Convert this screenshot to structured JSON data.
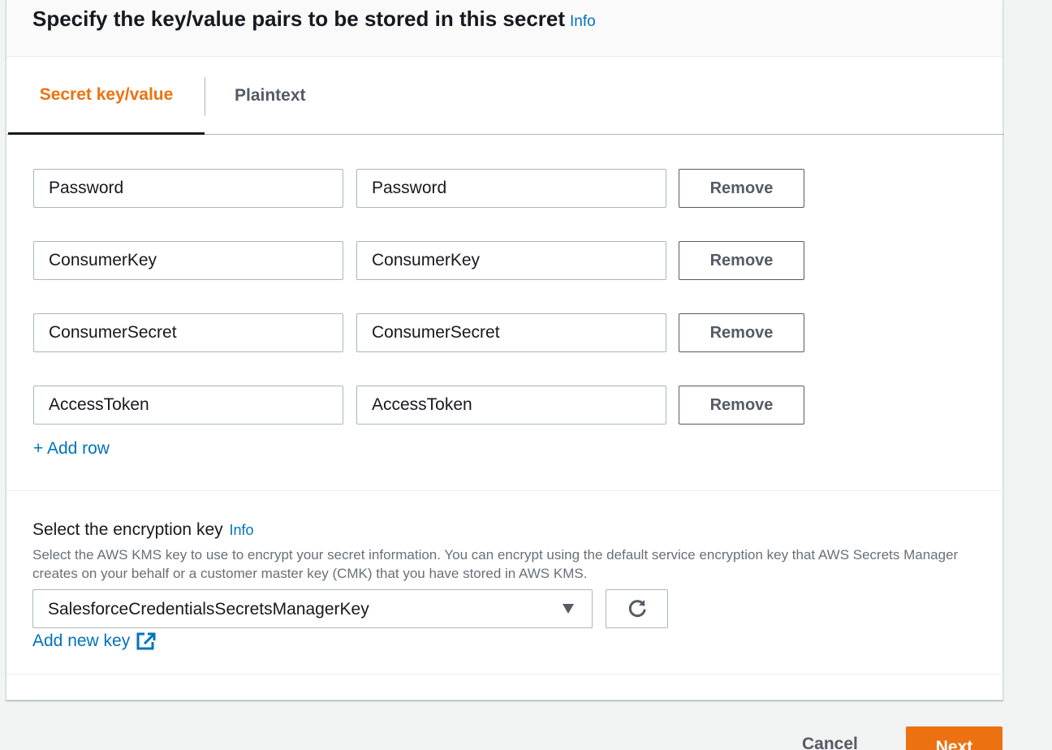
{
  "header": {
    "title": "Specify the key/value pairs to be stored in this secret",
    "info_label": "Info"
  },
  "tabs": [
    {
      "label": "Secret key/value",
      "active": true
    },
    {
      "label": "Plaintext",
      "active": false
    }
  ],
  "pairs": [
    {
      "key": "Password",
      "value": "Password",
      "remove_label": "Remove"
    },
    {
      "key": "ConsumerKey",
      "value": "ConsumerKey",
      "remove_label": "Remove"
    },
    {
      "key": "ConsumerSecret",
      "value": "ConsumerSecret",
      "remove_label": "Remove"
    },
    {
      "key": "AccessToken",
      "value": "AccessToken",
      "remove_label": "Remove"
    }
  ],
  "add_row_label": "+ Add row",
  "encryption": {
    "label": "Select the encryption key",
    "info_label": "Info",
    "description": "Select the AWS KMS key to use to encrypt your secret information. You can encrypt using the default service encryption key that AWS Secrets Manager creates on your behalf or a customer master key (CMK) that you have stored in AWS KMS.",
    "selected_key": "SalesforceCredentialsSecretsManagerKey",
    "add_new_key_label": "Add new key"
  },
  "footer": {
    "cancel_label": "Cancel",
    "next_label": "Next"
  },
  "colors": {
    "accent": "#ec7211",
    "link": "#0073bb",
    "text": "#16191f",
    "background": "#f2f3f3"
  }
}
